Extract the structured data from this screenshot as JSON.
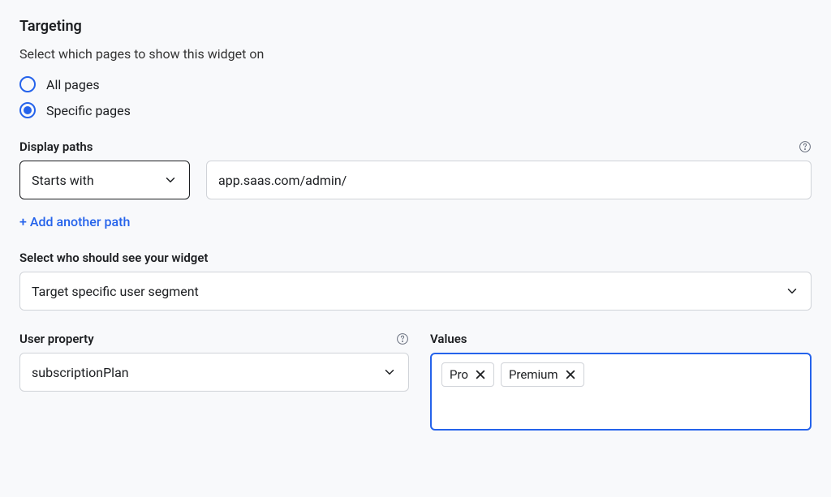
{
  "section": {
    "title": "Targeting",
    "description": "Select which pages to show this widget on"
  },
  "radios": {
    "all_pages": "All pages",
    "specific_pages": "Specific pages",
    "selected": "specific_pages"
  },
  "display_paths": {
    "label": "Display paths",
    "operator": "Starts with",
    "value": "app.saas.com/admin/",
    "add_link": "+ Add another path"
  },
  "audience": {
    "label": "Select who should see your widget",
    "value": "Target specific user segment"
  },
  "user_property": {
    "label": "User property",
    "value": "subscriptionPlan"
  },
  "values": {
    "label": "Values",
    "chips": [
      "Pro",
      "Premium"
    ]
  }
}
